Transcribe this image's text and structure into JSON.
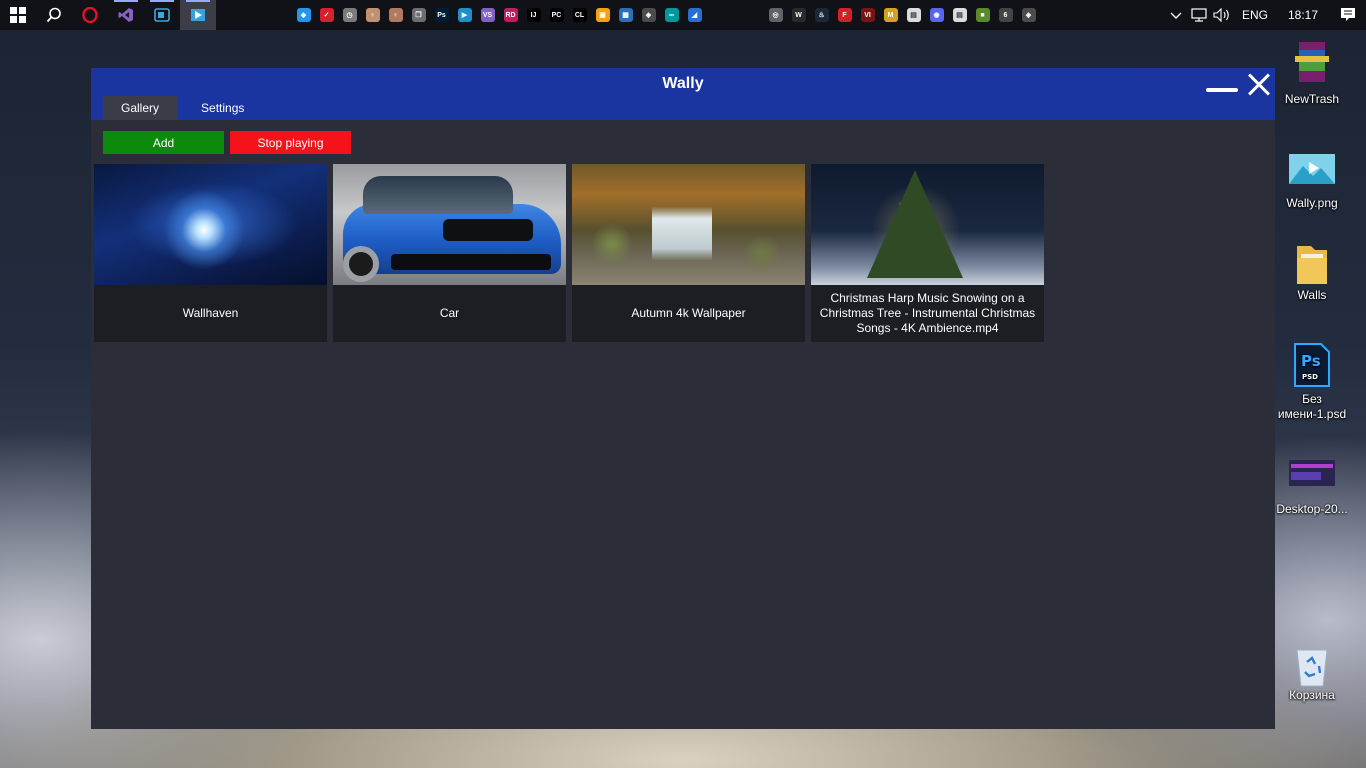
{
  "taskbar": {
    "start_icon": "windows-logo",
    "language": "ENG",
    "time": "18:17",
    "pinned_apps": [
      {
        "name": "search",
        "icon": "search-icon"
      },
      {
        "name": "opera",
        "icon": "opera-icon",
        "color": "#e81123",
        "glyph": "O"
      },
      {
        "name": "visual-studio",
        "icon": "visual-studio-icon",
        "color": "#8661c5",
        "glyph": "VS"
      },
      {
        "name": "media-app",
        "icon": "video-icon",
        "color": "#1e90c8",
        "glyph": "▶"
      },
      {
        "name": "wally",
        "icon": "wally-icon",
        "color": "#3aa0d8",
        "glyph": "▶"
      }
    ],
    "tray_left": [
      {
        "icon": "docker-icon",
        "color": "#2496ed",
        "glyph": "◆"
      },
      {
        "icon": "check-icon",
        "color": "#d8202c",
        "glyph": "✓"
      },
      {
        "icon": "clock-icon",
        "color": "#7b7b7b",
        "glyph": "◷"
      },
      {
        "icon": "character-icon",
        "color": "#c09070",
        "glyph": "♀"
      },
      {
        "icon": "character-icon",
        "color": "#b07a60",
        "glyph": "♀"
      },
      {
        "icon": "copy-icon",
        "color": "#6d6d6d",
        "glyph": "❐"
      },
      {
        "icon": "photoshop-icon",
        "color": "#001e36",
        "glyph": "Ps"
      },
      {
        "icon": "video-icon",
        "color": "#1e90c8",
        "glyph": "▶"
      },
      {
        "icon": "visual-studio-icon",
        "color": "#8661c5",
        "glyph": "VS"
      },
      {
        "icon": "rider-icon",
        "color": "#c21c5f",
        "glyph": "RD"
      },
      {
        "icon": "intellij-icon",
        "color": "#000000",
        "glyph": "IJ"
      },
      {
        "icon": "pycharm-icon",
        "color": "#000000",
        "glyph": "PC"
      },
      {
        "icon": "clion-icon",
        "color": "#000000",
        "glyph": "CL"
      },
      {
        "icon": "window-icon",
        "color": "#f2a30f",
        "glyph": "▣"
      },
      {
        "icon": "image-icon",
        "color": "#2d6fb5",
        "glyph": "▦"
      },
      {
        "icon": "unity-icon",
        "color": "#4c4c4c",
        "glyph": "◈"
      },
      {
        "icon": "arduino-icon",
        "color": "#00979d",
        "glyph": "∞"
      },
      {
        "icon": "blender-icon",
        "color": "#2a6fd0",
        "glyph": "◢"
      }
    ],
    "tray_right": [
      {
        "icon": "chrome-icon",
        "color": "#5f6368",
        "glyph": "◎"
      },
      {
        "icon": "epic-icon",
        "color": "#2a2a2a",
        "glyph": "W"
      },
      {
        "icon": "steam-icon",
        "color": "#1b2838",
        "glyph": "♨"
      },
      {
        "icon": "forza-icon",
        "color": "#d41f28",
        "glyph": "F"
      },
      {
        "icon": "vi-icon",
        "color": "#7a1414",
        "glyph": "VI"
      },
      {
        "icon": "mego-icon",
        "color": "#d4a21b",
        "glyph": "M"
      },
      {
        "icon": "document-icon",
        "color": "#dcdcdc",
        "glyph": "▤"
      },
      {
        "icon": "discord-icon",
        "color": "#5865f2",
        "glyph": "◉"
      },
      {
        "icon": "document-icon",
        "color": "#dcdcdc",
        "glyph": "▤"
      },
      {
        "icon": "minecraft-icon",
        "color": "#5a8a2a",
        "glyph": "■"
      },
      {
        "icon": "app-icon",
        "color": "#444",
        "glyph": "6"
      },
      {
        "icon": "unity-icon",
        "color": "#4c4c4c",
        "glyph": "◈"
      }
    ],
    "system_icons": [
      "chevron-up-icon",
      "network-icon",
      "volume-icon"
    ],
    "notification_icon": "notification-icon"
  },
  "desktop_icons": [
    {
      "label": "NewTrash",
      "icon": "winrar-archive-icon"
    },
    {
      "label": "Wally.png",
      "icon": "image-file-icon"
    },
    {
      "label": "Walls",
      "icon": "folder-icon"
    },
    {
      "label": "Без имени-1.psd",
      "icon": "photoshop-file-icon"
    },
    {
      "label": "Desktop-20...",
      "icon": "video-file-icon"
    },
    {
      "label": "Корзина",
      "icon": "recycle-bin-icon"
    }
  ],
  "app": {
    "title": "Wally",
    "tabs": [
      {
        "label": "Gallery",
        "active": true
      },
      {
        "label": "Settings",
        "active": false
      }
    ],
    "buttons": {
      "add": "Add",
      "stop": "Stop playing"
    },
    "colors": {
      "titlebar": "#1a35a0",
      "background": "#2b2d38",
      "add_button": "#0b8a0b",
      "stop_button": "#f4131b"
    },
    "gallery": [
      {
        "caption": "Wallhaven",
        "thumb": "nebula"
      },
      {
        "caption": "Car",
        "thumb": "car"
      },
      {
        "caption": "Autumn 4k Wallpaper",
        "thumb": "autumn"
      },
      {
        "caption": "Christmas Harp Music  Snowing on a Christmas Tree - Instrumental Christmas Songs - 4K Ambience.mp4",
        "thumb": "xmas"
      }
    ]
  }
}
